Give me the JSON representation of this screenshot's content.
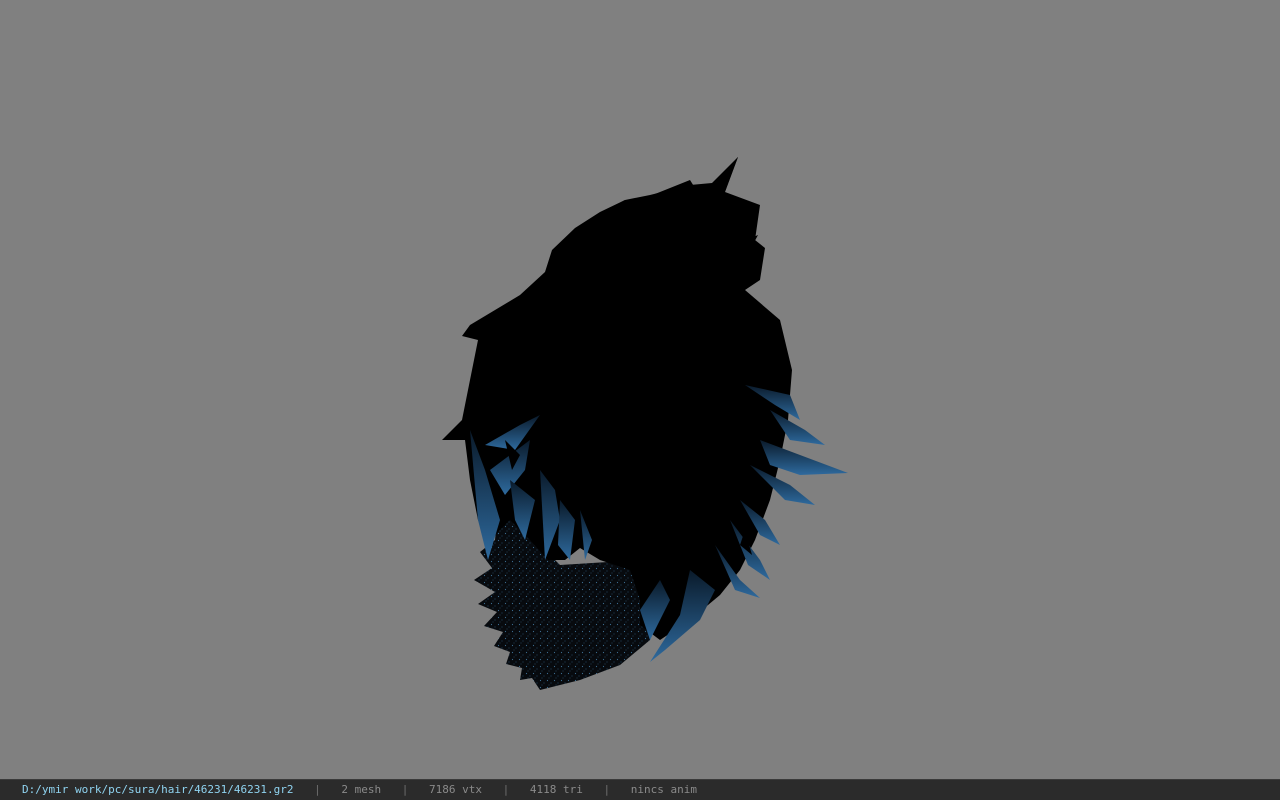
{
  "viewer": {
    "background_color": "#808080",
    "model_colors": {
      "hair_base": "#000000",
      "hair_highlight": "#2e6a9e",
      "scarf_speckle": "#3b6c8f"
    }
  },
  "status_bar": {
    "file_path": "D:/ymir work/pc/sura/hair/46231/46231.gr2",
    "separator": "|",
    "mesh_count": "2 mesh",
    "vertex_count": "7186 vtx",
    "triangle_count": "4118 tri",
    "anim_status": "nincs anim"
  }
}
